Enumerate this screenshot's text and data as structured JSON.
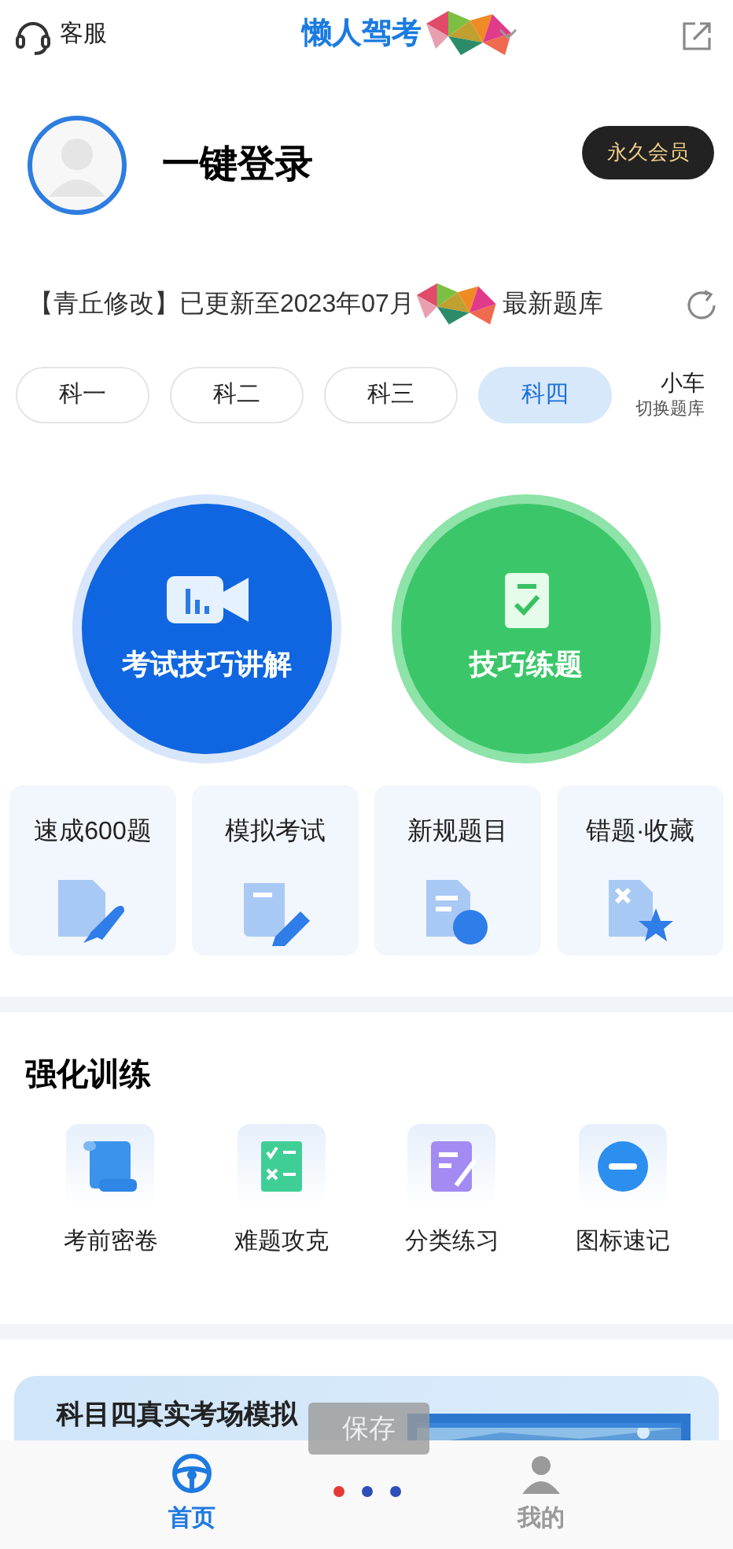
{
  "header": {
    "service_label": "客服",
    "title": "懒人驾考"
  },
  "profile": {
    "login": "一键登录",
    "vip": "永久会员"
  },
  "update": {
    "prefix": "【青丘修改】已更新至2023年07月",
    "suffix": "最新题库"
  },
  "subjects": [
    {
      "label": "科一",
      "selected": false
    },
    {
      "label": "科二",
      "selected": false
    },
    {
      "label": "科三",
      "selected": false
    },
    {
      "label": "科四",
      "selected": true
    }
  ],
  "switch": {
    "label": "小车",
    "sub": "切换题库"
  },
  "big_buttons": [
    {
      "label": "考试技巧讲解",
      "kind": "video"
    },
    {
      "label": "技巧练题",
      "kind": "checklist"
    }
  ],
  "quick_cards": [
    {
      "label": "速成600题",
      "kind": "rocket"
    },
    {
      "label": "模拟考试",
      "kind": "exam"
    },
    {
      "label": "新规题目",
      "kind": "new"
    },
    {
      "label": "错题·收藏",
      "kind": "star"
    }
  ],
  "training": {
    "title": "强化训练",
    "items": [
      {
        "label": "考前密卷",
        "kind": "scroll"
      },
      {
        "label": "难题攻克",
        "kind": "checklist"
      },
      {
        "label": "分类练习",
        "kind": "note"
      },
      {
        "label": "图标速记",
        "kind": "minus"
      }
    ]
  },
  "banner": {
    "title": "科目四真实考场模拟"
  },
  "save_overlay": "保存",
  "page_dots": [
    {
      "color": "#e53935"
    },
    {
      "color": "#2f4fb8"
    },
    {
      "color": "#2f4fb8"
    }
  ],
  "tab_bar": [
    {
      "label": "首页",
      "kind": "wheel",
      "selected": true
    },
    {
      "label": "我的",
      "kind": "person",
      "selected": false
    }
  ]
}
